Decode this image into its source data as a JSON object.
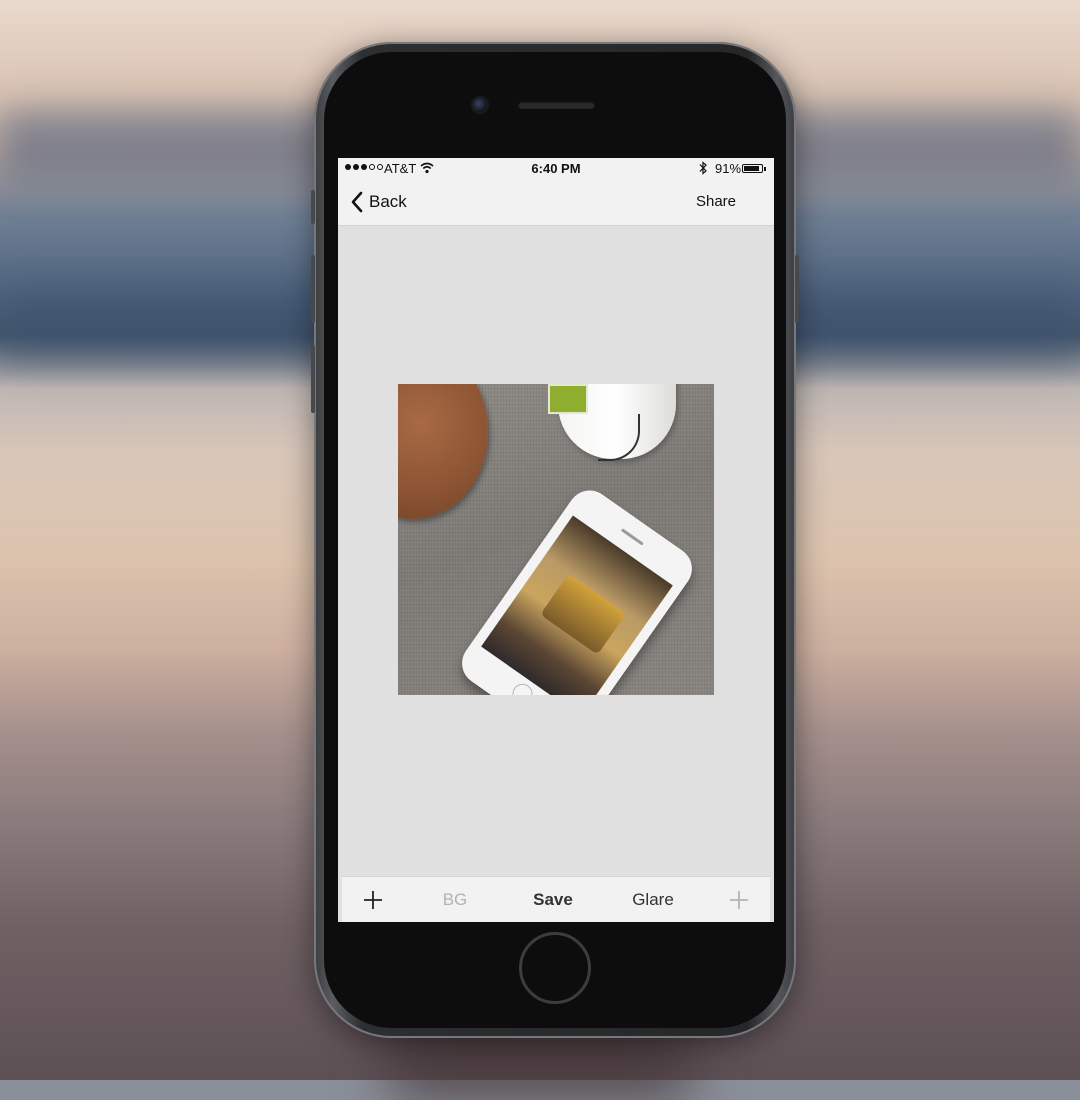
{
  "status_bar": {
    "carrier": "AT&T",
    "time": "6:40 PM",
    "battery_percent": "91%",
    "signal_bars_filled": 3,
    "signal_bars_total": 5,
    "battery_level": 0.91
  },
  "nav": {
    "back_label": "Back",
    "share_label": "Share"
  },
  "toolbar": {
    "add_label": "+",
    "bg_label": "BG",
    "save_label": "Save",
    "glare_label": "Glare",
    "add_right_label": "+"
  },
  "colors": {
    "screen_bg": "#e0e0e0",
    "bar_bg": "#f2f2f2",
    "disabled_text": "#b3b3b3"
  }
}
